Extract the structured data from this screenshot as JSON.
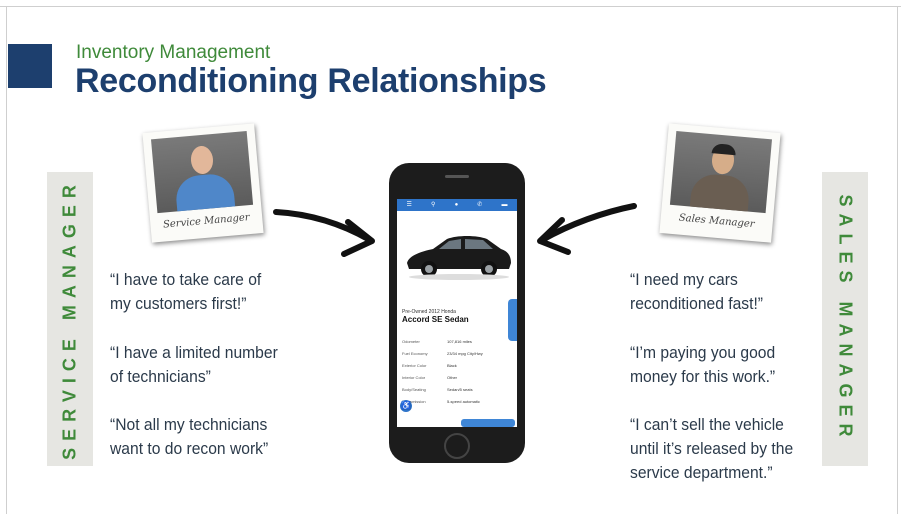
{
  "header": {
    "subtitle": "Inventory Management",
    "title": "Reconditioning Relationships"
  },
  "left": {
    "role_label": "SERVICE MANAGER",
    "photo_caption": "Service Manager",
    "quotes": [
      "“I have to take care of",
      "my customers first!”",
      "“I have a limited number",
      "of technicians”",
      "“Not all my technicians",
      "want to do recon work”"
    ]
  },
  "right": {
    "role_label": "SALES MANAGER",
    "photo_caption": "Sales Manager",
    "quotes": [
      "“I need my cars",
      "reconditioned fast!”",
      "“I’m paying you good",
      "money for this work.”",
      "“I can’t sell the vehicle",
      "until it’s released by the",
      "service department.”"
    ]
  },
  "phone": {
    "listing_type": "Pre-Owned 2012 Honda",
    "car_name": "Accord SE Sedan",
    "specs": [
      {
        "label": "Odometer",
        "value": "107,816 miles"
      },
      {
        "label": "Fuel Economy",
        "value": "23/34 mpg City/Hwy"
      },
      {
        "label": "Exterior Color",
        "value": "Black"
      },
      {
        "label": "Interior Color",
        "value": "Other"
      },
      {
        "label": "Body/Seating",
        "value": "Sedan/5 seats"
      },
      {
        "label": "Transmission",
        "value": "5-speed automatic"
      }
    ]
  },
  "colors": {
    "navy": "#1d3f6e",
    "green": "#3f8a3a",
    "sidebar_bg": "#e6e6e2"
  }
}
